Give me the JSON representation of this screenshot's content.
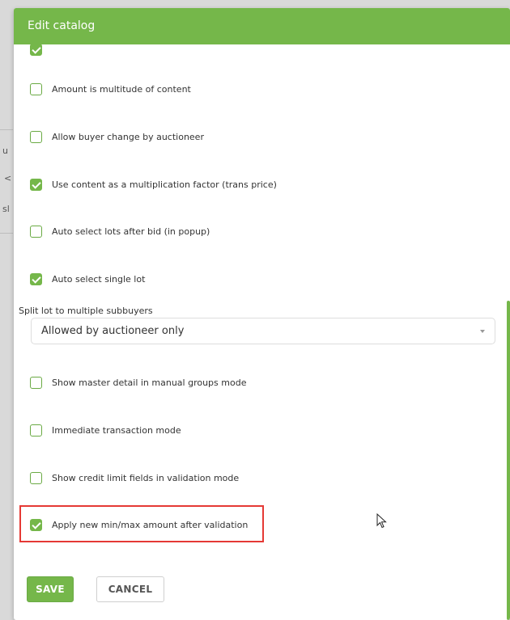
{
  "dialog": {
    "title": "Edit catalog",
    "checkboxes": [
      {
        "label": "Amount is multitude of content",
        "checked": false
      },
      {
        "label": "Allow buyer change by auctioneer",
        "checked": false
      },
      {
        "label": "Use content as a multiplication factor (trans price)",
        "checked": true
      },
      {
        "label": "Auto select lots after bid (in popup)",
        "checked": false
      },
      {
        "label": "Auto select single lot",
        "checked": true
      },
      {
        "label": "Show master detail in manual groups mode",
        "checked": false
      },
      {
        "label": "Immediate transaction mode",
        "checked": false
      },
      {
        "label": "Show credit limit fields in validation mode",
        "checked": false
      },
      {
        "label": "Apply new min/max amount after validation",
        "checked": true
      }
    ],
    "split_lot": {
      "label": "Split lot to multiple subbuyers",
      "value": "Allowed by auctioneer only"
    },
    "buttons": {
      "save": "SAVE",
      "cancel": "CANCEL"
    }
  },
  "colors": {
    "accent": "#75b74a",
    "highlight": "#e53935"
  }
}
